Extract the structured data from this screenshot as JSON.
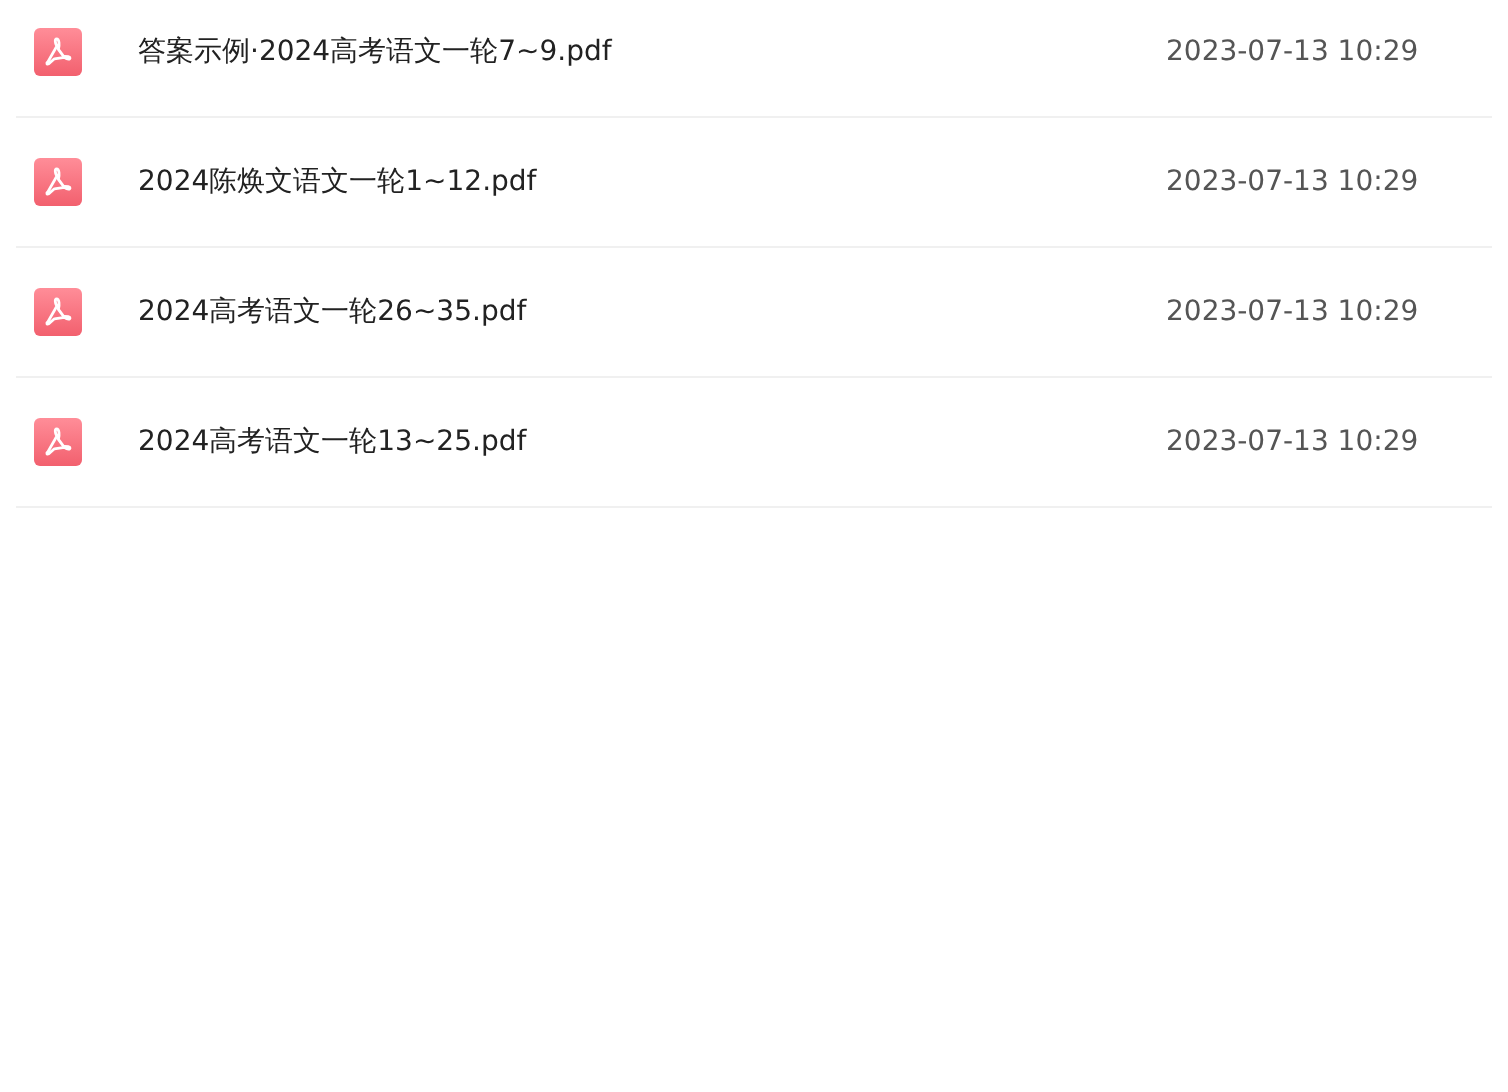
{
  "files": [
    {
      "kind": "pdf",
      "name": "答案示例·2024高考语文一轮7~9.pdf",
      "time": "2023-07-13 10:29"
    },
    {
      "kind": "pdf",
      "name": "2024陈焕文语文一轮1~12.pdf",
      "time": "2023-07-13 10:29"
    },
    {
      "kind": "pdf",
      "name": "2024高考语文一轮26~35.pdf",
      "time": "2023-07-13 10:29"
    },
    {
      "kind": "pdf",
      "name": "2024高考语文一轮13~25.pdf",
      "time": "2023-07-13 10:29"
    }
  ]
}
